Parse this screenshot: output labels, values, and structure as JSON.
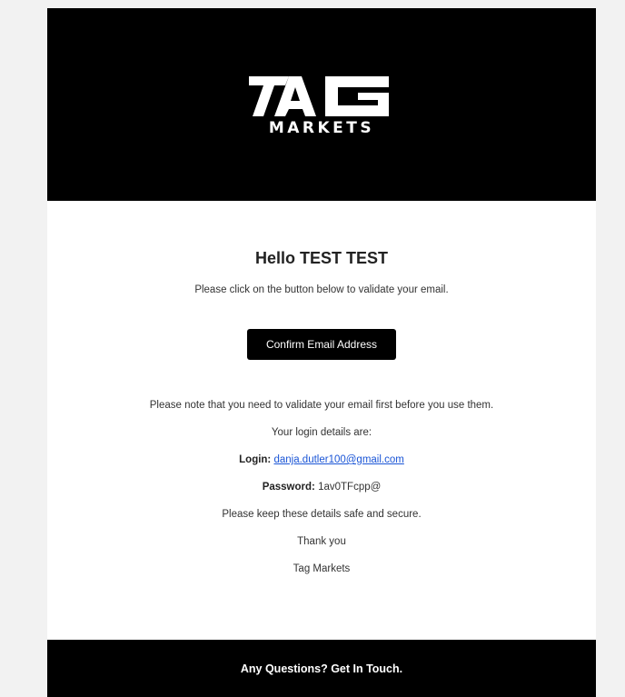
{
  "header": {
    "logo_text": "TAG",
    "logo_subtitle": "MARKETS"
  },
  "body": {
    "greeting": "Hello TEST TEST",
    "intro": "Please click on the button below to validate your email.",
    "button_label": "Confirm Email Address",
    "note": "Please note that you need to validate your email first before you use them.",
    "details_intro": "Your login details are:",
    "login_label": "Login:",
    "login_value": "danja.dutler100@gmail.com",
    "password_label": "Password:",
    "password_value": "1av0TFcpp@",
    "safe_note": "Please keep these details safe and secure.",
    "thanks": "Thank you",
    "signature": "Tag Markets"
  },
  "footer": {
    "text": "Any Questions? Get In Touch."
  },
  "colors": {
    "header_bg": "#000000",
    "button_bg": "#000000",
    "link": "#1a55d6",
    "page_bg": "#f2f2f2"
  }
}
